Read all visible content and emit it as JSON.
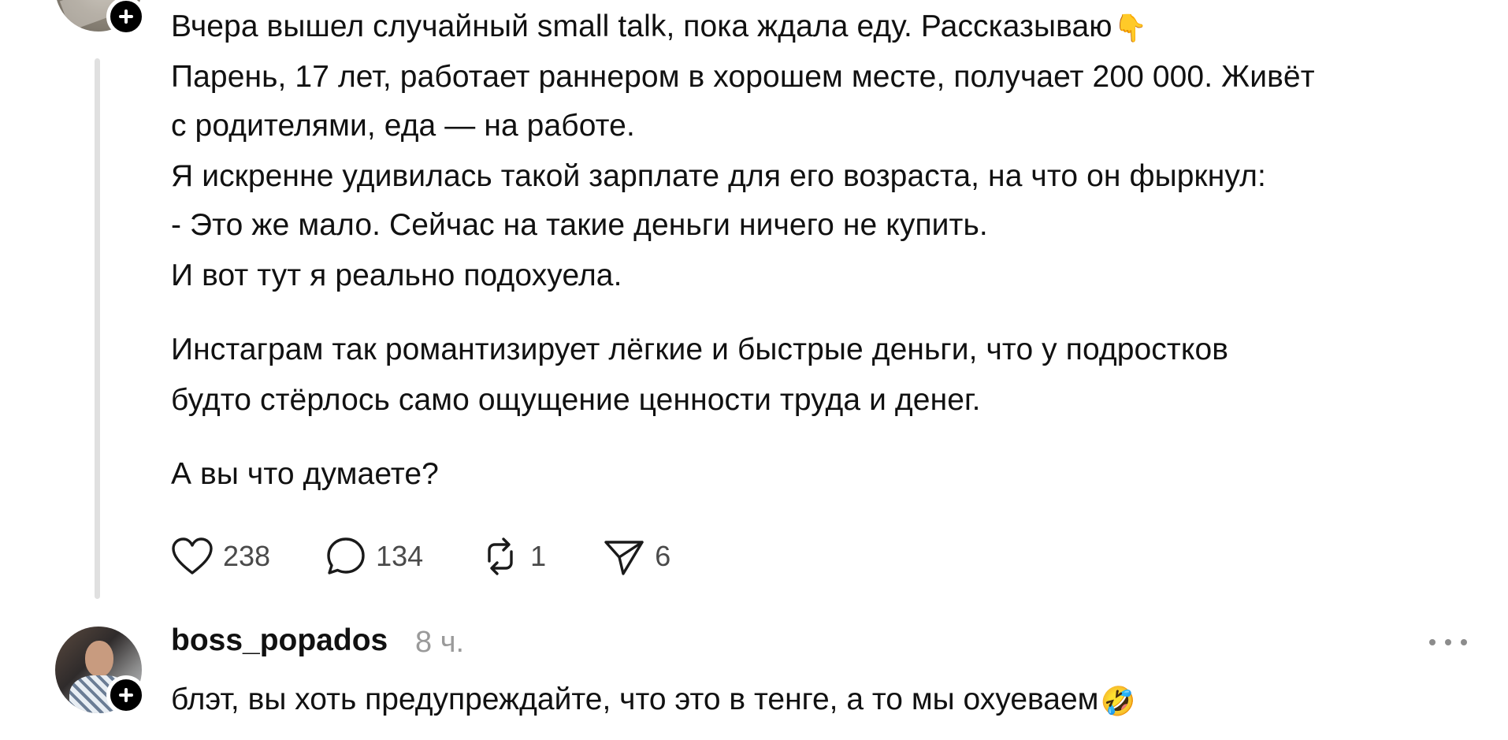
{
  "post": {
    "lines": [
      "Вчера вышел случайный small talk, пока ждала еду. Рассказываю",
      "Парень, 17 лет, работает раннером в хорошем месте, получает 200 000. Живёт",
      "с родителями, еда — на работе.",
      "Я искренне удивилась такой зарплате для его возраста, на что он фыркнул:",
      "- Это же мало. Сейчас на такие деньги ничего не купить.",
      "И вот тут я реально подохуела.",
      "Инстаграм так романтизирует лёгкие и быстрые деньги, что у подростков",
      "будто стёрлось само ощущение ценности труда и денег.",
      "А вы что думаете?"
    ],
    "pointer_emoji": "👇",
    "stats": {
      "likes": "238",
      "comments": "134",
      "reposts": "1",
      "shares": "6"
    }
  },
  "reply": {
    "username": "boss_popados",
    "time": "8 ч.",
    "text": "блэт, вы хоть предупреждайте, что это в тенге, а то мы охуеваем",
    "emoji": "🤣"
  },
  "icons": {
    "like": "heart-icon",
    "comment": "comment-bubble-icon",
    "repost": "repost-icon",
    "share": "send-icon",
    "more": "more-dots-icon",
    "follow": "plus-icon"
  },
  "colors": {
    "text": "#111111",
    "muted": "#9a9a9a",
    "thread_line": "#e0e0e0",
    "badge": "#000000"
  }
}
